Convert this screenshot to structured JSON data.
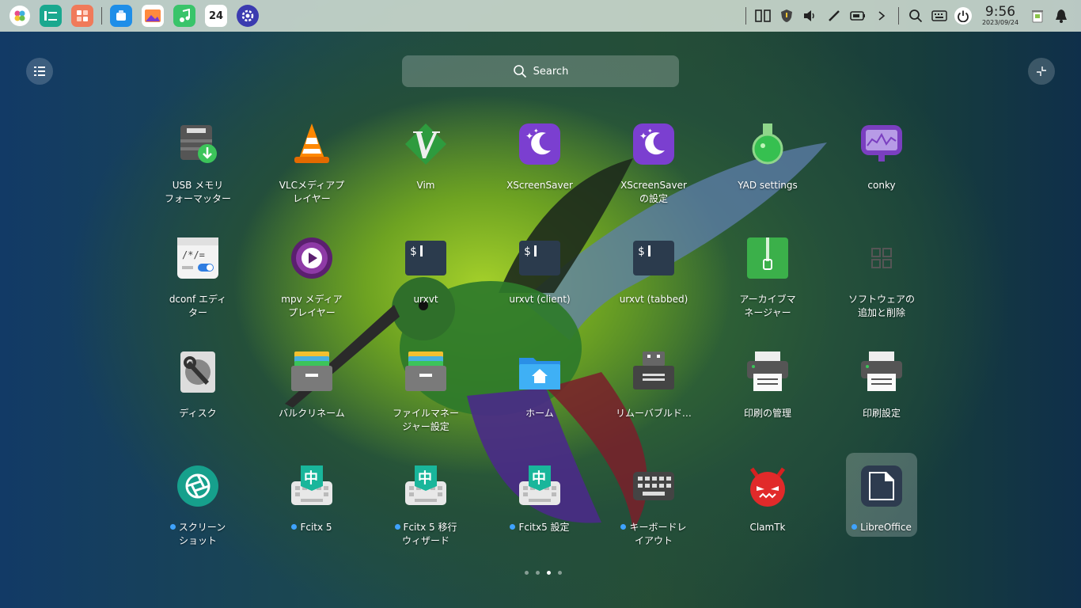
{
  "panel": {
    "dock": [
      {
        "name": "launcher-icon"
      },
      {
        "name": "file-manager-icon"
      },
      {
        "name": "app-store-icon"
      },
      {
        "name": "browser-icon"
      },
      {
        "name": "image-viewer-icon"
      },
      {
        "name": "music-icon"
      },
      {
        "name": "calendar-icon",
        "day": "24"
      },
      {
        "name": "settings-icon"
      }
    ],
    "clock": {
      "time": "9:56",
      "date": "2023/09/24"
    }
  },
  "search": {
    "placeholder": "Search"
  },
  "apps": [
    {
      "label": "USB メモリ\nフォーマッター",
      "icon": "usb-formatter-icon",
      "new": false
    },
    {
      "label": "VLCメディアプ\nレイヤー",
      "icon": "vlc-icon",
      "new": false
    },
    {
      "label": "Vim",
      "icon": "vim-icon",
      "new": false
    },
    {
      "label": "XScreenSaver",
      "icon": "xscreensaver-icon",
      "new": false
    },
    {
      "label": "XScreenSaver\nの設定",
      "icon": "xscreensaver-settings-icon",
      "new": false
    },
    {
      "label": "YAD settings",
      "icon": "yad-icon",
      "new": false
    },
    {
      "label": "conky",
      "icon": "conky-icon",
      "new": false
    },
    {
      "label": "dconf エディ\nター",
      "icon": "dconf-icon",
      "new": false
    },
    {
      "label": "mpv メディア\nプレイヤー",
      "icon": "mpv-icon",
      "new": false
    },
    {
      "label": "urxvt",
      "icon": "terminal-icon",
      "new": false
    },
    {
      "label": "urxvt (client)",
      "icon": "terminal-icon",
      "new": false
    },
    {
      "label": "urxvt (tabbed)",
      "icon": "terminal-icon",
      "new": false
    },
    {
      "label": "アーカイブマ\nネージャー",
      "icon": "archive-icon",
      "new": false
    },
    {
      "label": "ソフトウェアの\n追加と削除",
      "icon": "software-icon",
      "new": false
    },
    {
      "label": "ディスク",
      "icon": "disk-icon",
      "new": false
    },
    {
      "label": "バルクリネーム",
      "icon": "bulk-rename-icon",
      "new": false
    },
    {
      "label": "ファイルマネー\nジャー設定",
      "icon": "file-manager-settings-icon",
      "new": false
    },
    {
      "label": "ホーム",
      "icon": "home-folder-icon",
      "new": false
    },
    {
      "label": "リムーバブルド…",
      "icon": "removable-drive-icon",
      "new": false
    },
    {
      "label": "印刷の管理",
      "icon": "print-manager-icon",
      "new": false
    },
    {
      "label": "印刷設定",
      "icon": "printer-settings-icon",
      "new": false
    },
    {
      "label": "スクリーン\nショット",
      "icon": "screenshot-icon",
      "new": true
    },
    {
      "label": "Fcitx 5",
      "icon": "fcitx-icon",
      "new": true
    },
    {
      "label": "Fcitx 5 移行\nウィザード",
      "icon": "fcitx-icon",
      "new": true
    },
    {
      "label": "Fcitx5 設定",
      "icon": "fcitx-icon",
      "new": true
    },
    {
      "label": "キーボードレ\nイアウト",
      "icon": "keyboard-icon",
      "new": true
    },
    {
      "label": "ClamTk",
      "icon": "clamtk-icon",
      "new": false
    },
    {
      "label": "LibreOffice",
      "icon": "libreoffice-icon",
      "new": true,
      "selected": true
    }
  ],
  "pager": {
    "pages": 4,
    "current": 3
  }
}
